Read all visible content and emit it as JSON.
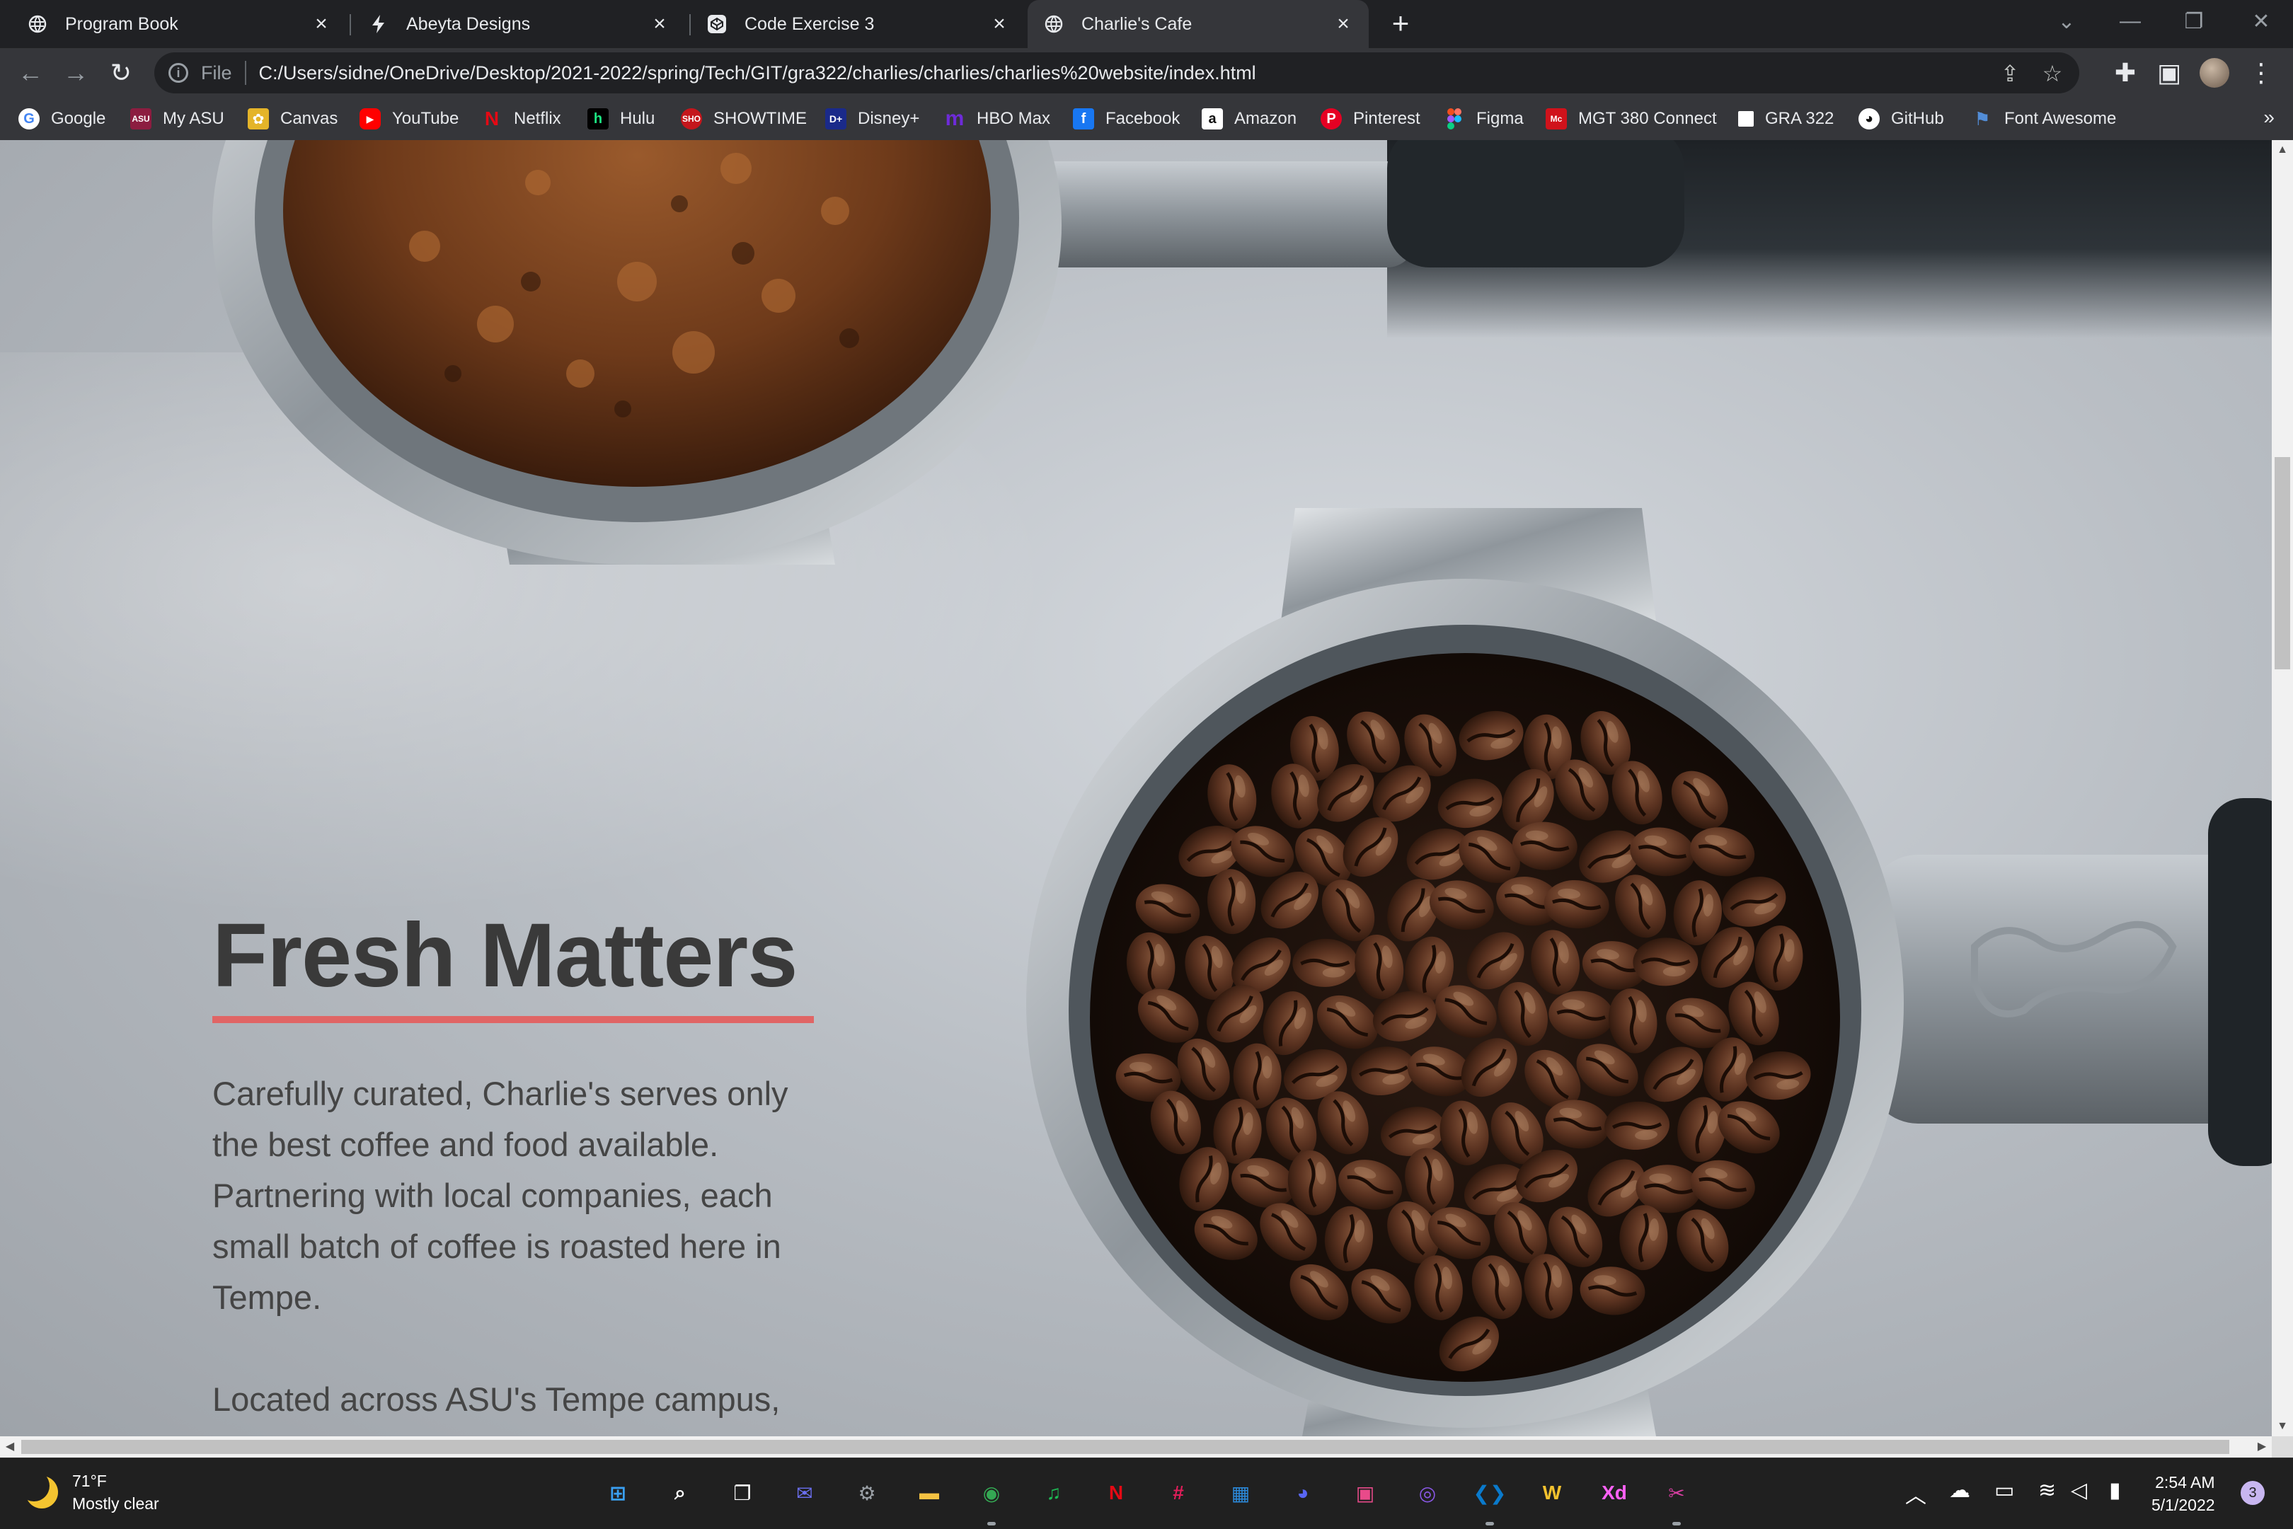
{
  "browser": {
    "tabs": [
      {
        "title": "Program Book",
        "icon": "globe-icon",
        "active": false
      },
      {
        "title": "Abeyta Designs",
        "icon": "bolt-icon",
        "active": false
      },
      {
        "title": "Code Exercise 3",
        "icon": "codepen-icon",
        "active": false
      },
      {
        "title": "Charlie's Cafe",
        "icon": "globe-icon",
        "active": true
      }
    ],
    "new_tab_label": "+",
    "address": {
      "scheme_label": "File",
      "url": "C:/Users/sidne/OneDrive/Desktop/2021-2022/spring/Tech/GIT/gra322/charlies/charlies/charlies%20website/index.html"
    },
    "bookmarks": [
      {
        "label": "Google",
        "icon": "google-icon",
        "color": "#4285f4"
      },
      {
        "label": "My ASU",
        "icon": "asu-icon",
        "color": "#8c1d40"
      },
      {
        "label": "Canvas",
        "icon": "canvas-icon",
        "color": "#e4b429"
      },
      {
        "label": "YouTube",
        "icon": "youtube-icon",
        "color": "#ff0000"
      },
      {
        "label": "Netflix",
        "icon": "netflix-icon",
        "color": "#e50914"
      },
      {
        "label": "Hulu",
        "icon": "hulu-icon",
        "color": "#1ce783"
      },
      {
        "label": "SHOWTIME",
        "icon": "showtime-icon",
        "color": "#c4161c"
      },
      {
        "label": "Disney+",
        "icon": "disney-icon",
        "color": "#1a2a8a"
      },
      {
        "label": "HBO Max",
        "icon": "hbomax-icon",
        "color": "#6e2bd9"
      },
      {
        "label": "Facebook",
        "icon": "facebook-icon",
        "color": "#1877f2"
      },
      {
        "label": "Amazon",
        "icon": "amazon-icon",
        "color": "#ffffff"
      },
      {
        "label": "Pinterest",
        "icon": "pinterest-icon",
        "color": "#e60023"
      },
      {
        "label": "Figma",
        "icon": "figma-icon",
        "color": "#a259ff"
      },
      {
        "label": "MGT 380 Connect",
        "icon": "mgt-icon",
        "color": "#d0121b"
      },
      {
        "label": "GRA 322",
        "icon": "folder-icon",
        "color": "#ffffff"
      },
      {
        "label": "GitHub",
        "icon": "github-icon",
        "color": "#ffffff"
      },
      {
        "label": "Font Awesome",
        "icon": "flag-icon",
        "color": "#528dd7"
      }
    ],
    "bookmarks_overflow": "»"
  },
  "page": {
    "heading": "Fresh Matters",
    "accent_color": "#e06565",
    "paragraph1": "Carefully curated, Charlie's serves only the best coffee and food available. Partnering with local companies, each small batch of coffee is roasted here in Tempe.",
    "paragraph2": "Located across ASU's Tempe campus, Charlie's prides itself in spectacular coffee, food, and community."
  },
  "taskbar": {
    "weather_temp": "71°F",
    "weather_desc": "Mostly clear",
    "apps": [
      {
        "name": "windows-start-icon",
        "glyph": "⊞",
        "color": "#3aa0f3"
      },
      {
        "name": "search-icon",
        "glyph": "⌕",
        "color": "#ffffff"
      },
      {
        "name": "task-view-icon",
        "glyph": "❐",
        "color": "#ffffff"
      },
      {
        "name": "chat-icon",
        "glyph": "✉",
        "color": "#6b6ff0"
      },
      {
        "name": "settings-icon",
        "glyph": "⚙",
        "color": "#9aa0a6"
      },
      {
        "name": "file-explorer-icon",
        "glyph": "▬",
        "color": "#f5c242"
      },
      {
        "name": "chrome-icon",
        "glyph": "◉",
        "color": "#34a853"
      },
      {
        "name": "spotify-icon",
        "glyph": "♫",
        "color": "#1db954"
      },
      {
        "name": "netflix-icon",
        "glyph": "N",
        "color": "#e50914"
      },
      {
        "name": "slack-icon",
        "glyph": "#",
        "color": "#e01e5a"
      },
      {
        "name": "store-icon",
        "glyph": "▦",
        "color": "#2b88d8"
      },
      {
        "name": "discord-icon",
        "glyph": "◕",
        "color": "#5865f2"
      },
      {
        "name": "photos-icon",
        "glyph": "▣",
        "color": "#e94a8a"
      },
      {
        "name": "github-desktop-icon",
        "glyph": "◎",
        "color": "#8957e5"
      },
      {
        "name": "vscode-icon",
        "glyph": "❮❯",
        "color": "#0a7acc"
      },
      {
        "name": "miro-icon",
        "glyph": "W",
        "color": "#f2c12e"
      },
      {
        "name": "adobe-xd-icon",
        "glyph": "Xd",
        "color": "#ff61f6"
      },
      {
        "name": "snipping-tool-icon",
        "glyph": "✂",
        "color": "#d63ea0"
      }
    ],
    "time": "2:54 AM",
    "date": "5/1/2022",
    "notification_count": "3"
  }
}
